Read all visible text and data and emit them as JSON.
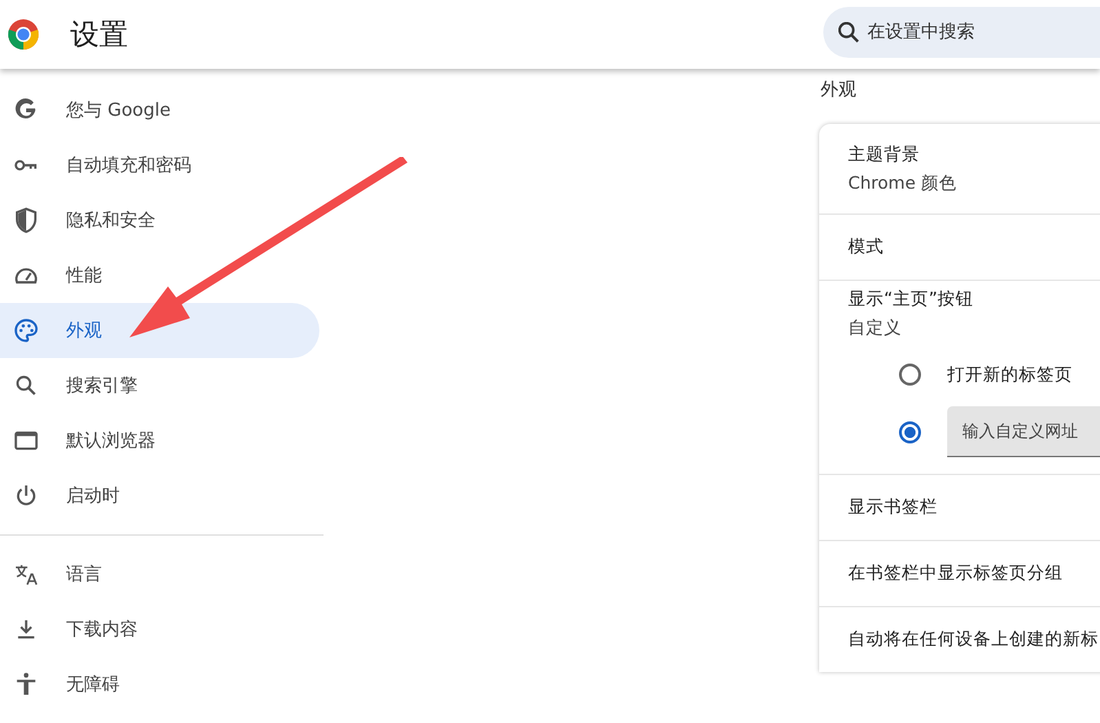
{
  "header": {
    "title": "设置",
    "search": {
      "placeholder": "在设置中搜索"
    }
  },
  "sidebar": {
    "groups": [
      [
        {
          "kind": "google",
          "label": "您与 Google",
          "selected": false
        },
        {
          "kind": "key",
          "label": "自动填充和密码",
          "selected": false
        },
        {
          "kind": "shield",
          "label": "隐私和安全",
          "selected": false
        },
        {
          "kind": "gauge",
          "label": "性能",
          "selected": false
        },
        {
          "kind": "palette",
          "label": "外观",
          "selected": true
        },
        {
          "kind": "search",
          "label": "搜索引擎",
          "selected": false
        },
        {
          "kind": "browser",
          "label": "默认浏览器",
          "selected": false
        },
        {
          "kind": "power",
          "label": "启动时",
          "selected": false
        }
      ],
      [
        {
          "kind": "translate",
          "label": "语言",
          "selected": false
        },
        {
          "kind": "download",
          "label": "下载内容",
          "selected": false
        },
        {
          "kind": "accessibility",
          "label": "无障碍",
          "selected": false
        }
      ]
    ]
  },
  "section": {
    "title": "外观",
    "rows": [
      {
        "kind": "text",
        "title": "主题背景",
        "subtitle": "Chrome 颜色"
      },
      {
        "kind": "text",
        "title": "模式"
      },
      {
        "kind": "radio",
        "title": "显示“主页”按钮",
        "subtitle": "自定义",
        "options": [
          {
            "label": "打开新的标签页",
            "selected": false
          },
          {
            "placeholder": "输入自定义网址",
            "selected": true
          }
        ]
      },
      {
        "kind": "text",
        "title": "显示书签栏"
      },
      {
        "kind": "text",
        "title": "在书签栏中显示标签页分组"
      },
      {
        "kind": "text",
        "title": "自动将在任何设备上创建的新标"
      }
    ]
  }
}
